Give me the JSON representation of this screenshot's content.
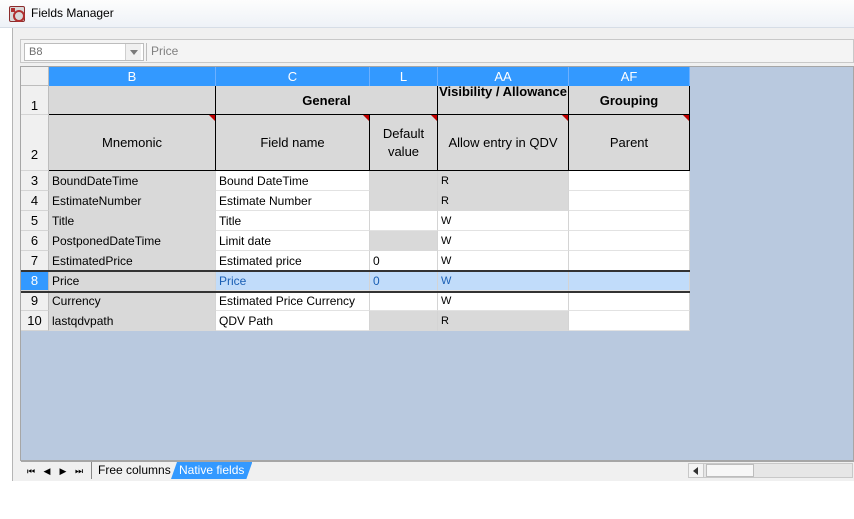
{
  "window": {
    "title": "Fields Manager"
  },
  "formula_bar": {
    "cell_ref": "B8",
    "value": "Price"
  },
  "columns": [
    "B",
    "C",
    "L",
    "AA",
    "AF"
  ],
  "rows": [
    "1",
    "2",
    "3",
    "4",
    "5",
    "6",
    "7",
    "8",
    "9",
    "10"
  ],
  "group_headers": {
    "general": "General",
    "visibility": "Visibility / Allowance",
    "grouping": "Grouping"
  },
  "field_headers": {
    "mnemonic": "Mnemonic",
    "field_name": "Field name",
    "default_value": "Default value",
    "allow_entry": "Allow entry in QDV",
    "parent": "Parent"
  },
  "data_rows": [
    {
      "mnemonic": "BoundDateTime",
      "field_name": "Bound DateTime",
      "default": "",
      "allow": "R",
      "parent": ""
    },
    {
      "mnemonic": "EstimateNumber",
      "field_name": "Estimate Number",
      "default": "",
      "allow": "R",
      "parent": ""
    },
    {
      "mnemonic": "Title",
      "field_name": "Title",
      "default": "",
      "allow": "W",
      "parent": ""
    },
    {
      "mnemonic": "PostponedDateTime",
      "field_name": "Limit date",
      "default": "",
      "allow": "W",
      "parent": ""
    },
    {
      "mnemonic": "EstimatedPrice",
      "field_name": "Estimated price",
      "default": "0",
      "allow": "W",
      "parent": ""
    },
    {
      "mnemonic": "Price",
      "field_name": "Price",
      "default": "0",
      "allow": "W",
      "parent": ""
    },
    {
      "mnemonic": "Currency",
      "field_name": "Estimated Price Currency",
      "default": "",
      "allow": "W",
      "parent": ""
    },
    {
      "mnemonic": "lastqdvpath",
      "field_name": "QDV Path",
      "default": "",
      "allow": "R",
      "parent": ""
    }
  ],
  "tabs": {
    "free_columns": "Free columns",
    "native_fields": "Native fields"
  },
  "nav": {
    "first": "⏮",
    "prev": "◀",
    "next": "▶",
    "last": "⏭"
  },
  "colors": {
    "selection": "#3399ff",
    "header_grey": "#d9d9d9",
    "background": "#b9c9df"
  }
}
